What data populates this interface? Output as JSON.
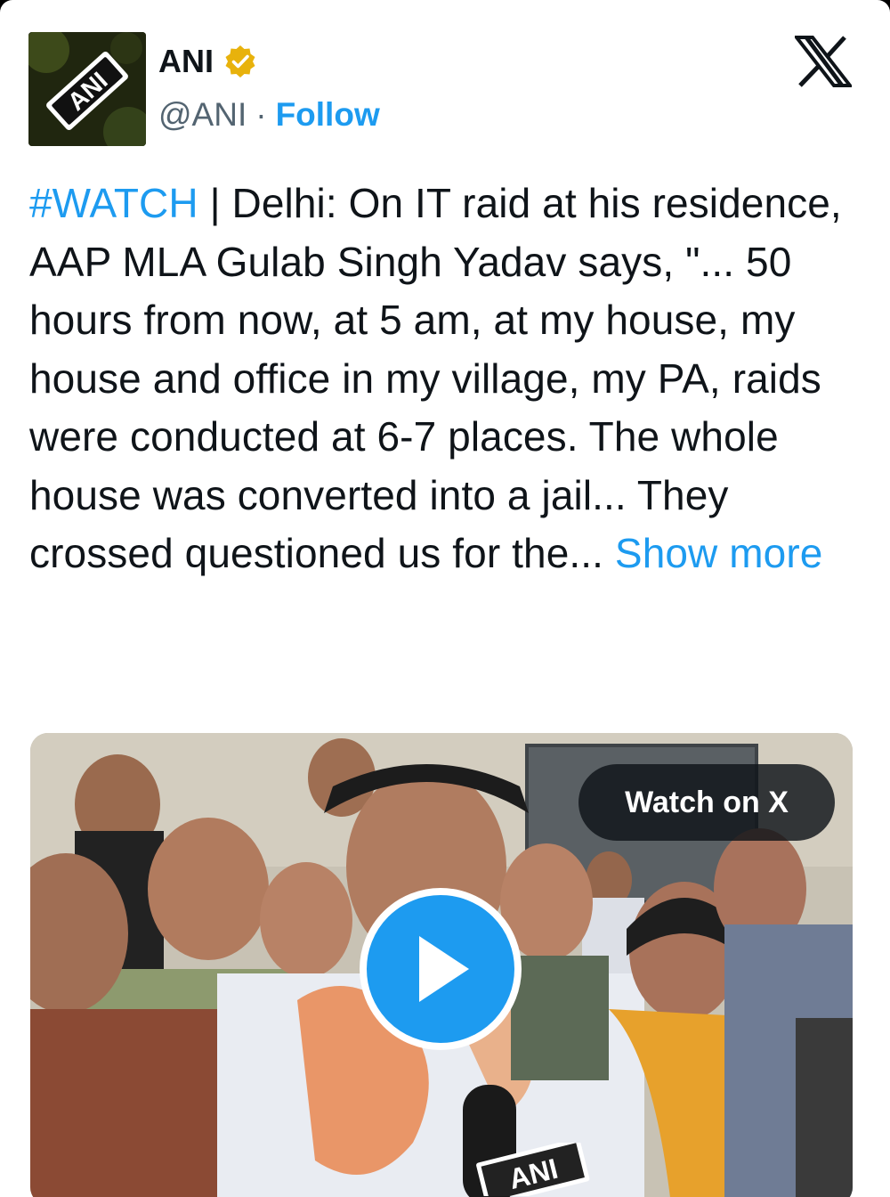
{
  "account": {
    "name": "ANI",
    "handle": "@ANI",
    "separator": "·",
    "follow_label": "Follow",
    "avatar_text": "ANI",
    "verified_color": "#e8b20c"
  },
  "platform_logo": "x-logo-icon",
  "tweet": {
    "hashtag": "#WATCH",
    "body": " | Delhi: On IT raid at his residence, AAP MLA Gulab Singh Yadav says, \"... 50 hours from now, at 5 am, at my house, my house and office in my village, my PA, raids were conducted at 6-7 places. The whole house was converted into a jail... They crossed questioned us for the... ",
    "show_more_label": "Show more"
  },
  "media": {
    "watch_label": "Watch on X",
    "play_icon": "play-icon",
    "watermark_text": "ANI"
  },
  "colors": {
    "accent": "#1d9bf0",
    "text": "#0f1419",
    "secondary": "#536471"
  }
}
